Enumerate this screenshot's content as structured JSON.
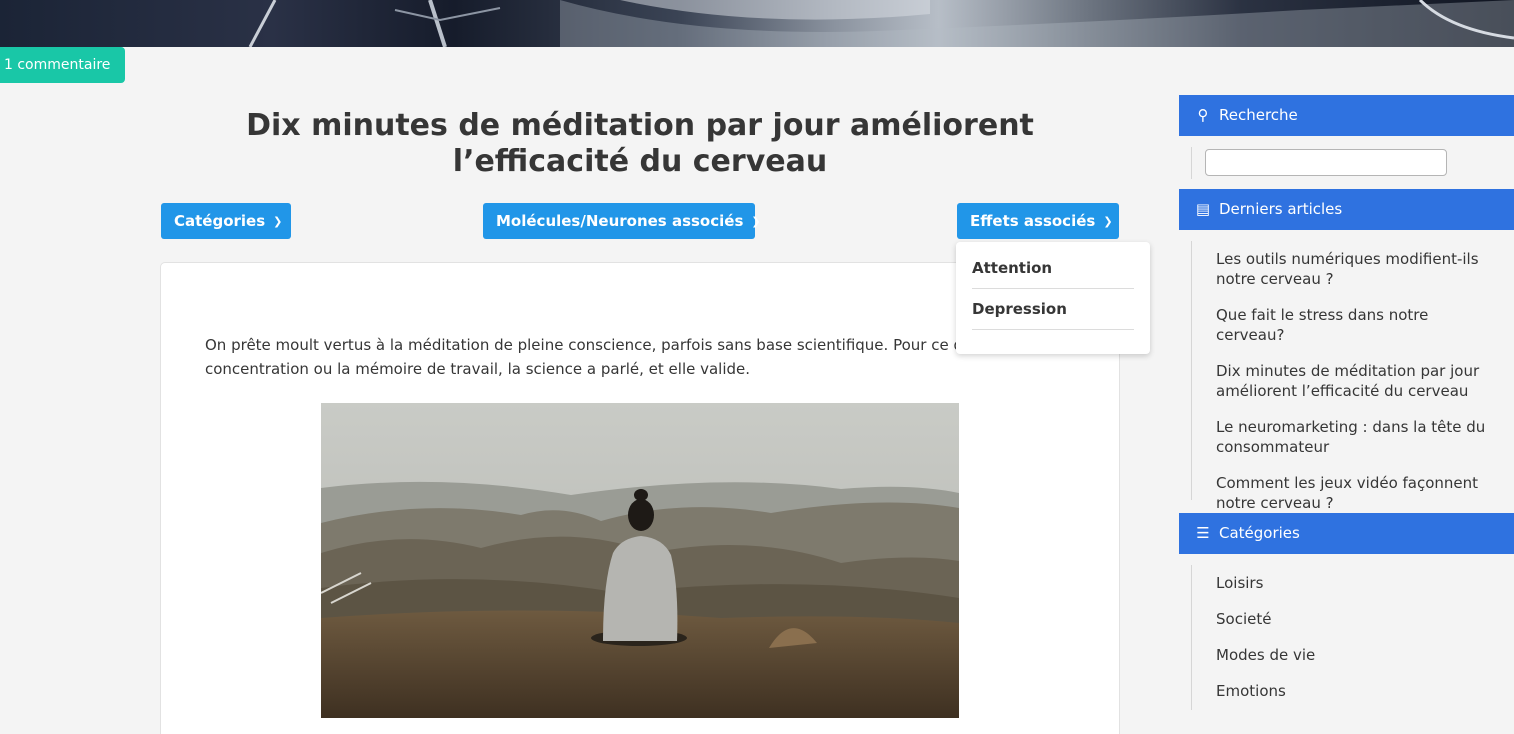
{
  "comment_badge": "1 commentaire",
  "article": {
    "title": "Dix minutes de méditation par jour améliorent l’efficacité du cerveau",
    "intro": "On prête moult vertus à la méditation de pleine conscience, parfois sans base scientifique. Pour ce qui est de la concentration ou la mémoire de travail, la science a parlé, et elle valide."
  },
  "filters": {
    "categories": "Catégories",
    "molecules": "Molécules/Neurones associés",
    "effects": "Effets associés"
  },
  "effects_menu": [
    "Attention",
    "Depression"
  ],
  "sidebar": {
    "search": {
      "title": "Recherche",
      "placeholder": ""
    },
    "latest": {
      "title": "Derniers articles",
      "items": [
        "Les outils numériques modifient-ils notre cerveau ?",
        "Que fait le stress dans notre cerveau?",
        "Dix minutes de méditation par jour améliorent l’efficacité du cerveau",
        "Le neuromarketing : dans la tête du consommateur",
        "Comment les jeux vidéo façonnent notre cerveau ?"
      ]
    },
    "categories": {
      "title": "Catégories",
      "items": [
        "Loisirs",
        "Societé",
        "Modes de vie",
        "Emotions"
      ]
    }
  },
  "icons": {
    "search": "search-icon",
    "latest": "newspaper-icon",
    "categories": "list-icon",
    "chevron": "chevron-down-icon"
  },
  "colors": {
    "button_blue": "#2196e8",
    "sidebar_header": "#2f72e0",
    "badge_teal": "#19c7a7"
  }
}
